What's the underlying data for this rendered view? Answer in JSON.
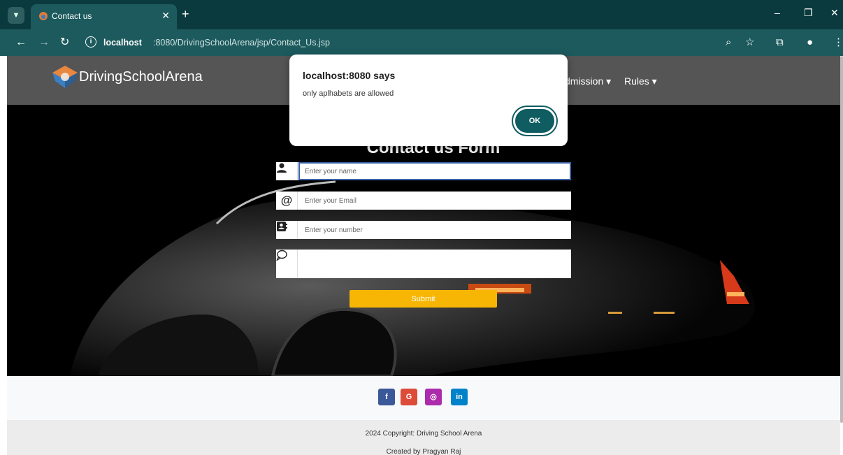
{
  "browser": {
    "tab_title": "Contact us",
    "tab_close": "✕",
    "new_tab": "+",
    "url_host": "localhost",
    "url_path": ":8080/DrivingSchoolArena/jsp/Contact_Us.jsp",
    "window_controls": {
      "minimize": "–",
      "restore": "❐",
      "close": "✕"
    }
  },
  "navbar": {
    "brand": "DrivingSchoolArena",
    "links": [
      {
        "label": "dmission ▾"
      },
      {
        "label": "Rules ▾"
      }
    ]
  },
  "form": {
    "title": "Contact us Form",
    "name_placeholder": "Enter your name",
    "email_placeholder": "Enter your Email",
    "number_placeholder": "Enter your number",
    "message_placeholder": "",
    "submit_label": "Submit"
  },
  "social": [
    {
      "label": "f",
      "icon": "facebook-icon",
      "color": "#3b5998"
    },
    {
      "label": "G",
      "icon": "google-icon",
      "color": "#dd4b39"
    },
    {
      "label": "◎",
      "icon": "instagram-icon",
      "color": "#ac2bac"
    },
    {
      "label": "in",
      "icon": "linkedin-icon",
      "color": "#0082ca"
    }
  ],
  "footer": {
    "copyright": "2024 Copyright: Driving School Arena",
    "created_by": "Created by Pragyan Raj"
  },
  "dialog": {
    "title": "localhost:8080 says",
    "message": "only aplhabets are allowed",
    "ok_label": "OK"
  },
  "colors": {
    "chrome_dark": "#0b3a3e",
    "chrome_toolbar": "#1c5a5d",
    "navbar": "#555555",
    "submit": "#f7b603",
    "dialog_button": "#0f5c61"
  }
}
